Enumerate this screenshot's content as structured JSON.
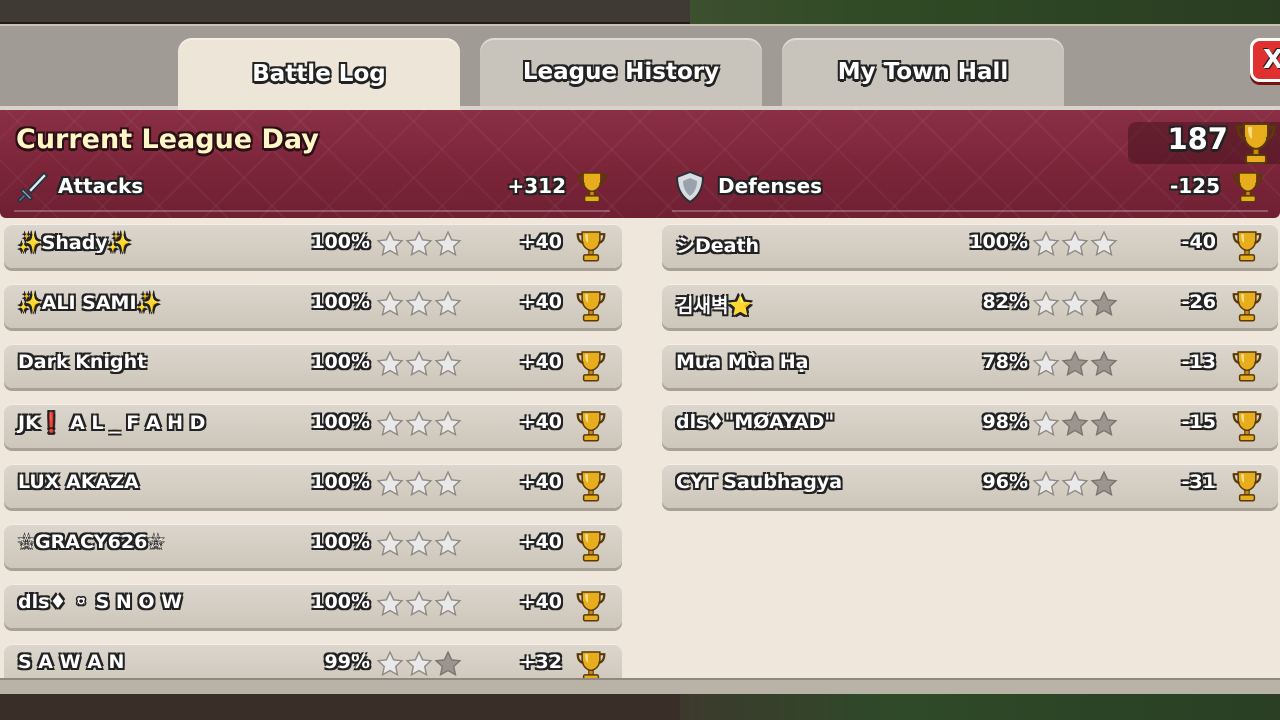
{
  "tabs": [
    {
      "label": "Battle Log",
      "active": true
    },
    {
      "label": "League History",
      "active": false
    },
    {
      "label": "My Town Hall",
      "active": false
    }
  ],
  "close_label": "X",
  "league": {
    "title": "Current League Day",
    "total_trophies": "187"
  },
  "attacks": {
    "label": "Attacks",
    "total": "+312",
    "rows": [
      {
        "name": "✨Shady✨",
        "percent": "100%",
        "stars": 3,
        "trophies": "+40"
      },
      {
        "name": "✨ALI SAMI✨",
        "percent": "100%",
        "stars": 3,
        "trophies": "+40"
      },
      {
        "name": "Dark Knight",
        "percent": "100%",
        "stars": 3,
        "trophies": "+40"
      },
      {
        "name": "JK❗ A L _ F A H D",
        "percent": "100%",
        "stars": 3,
        "trophies": "+40"
      },
      {
        "name": "LUX AKAZA",
        "percent": "100%",
        "stars": 3,
        "trophies": "+40"
      },
      {
        "name": "☆GRACY626☆",
        "percent": "100%",
        "stars": 3,
        "trophies": "+40"
      },
      {
        "name": "dls♦ ⚬ S N O W",
        "percent": "100%",
        "stars": 3,
        "trophies": "+40"
      },
      {
        "name": "S A W A N",
        "percent": "99%",
        "stars": 2,
        "trophies": "+32"
      }
    ]
  },
  "defenses": {
    "label": "Defenses",
    "total": "-125",
    "rows": [
      {
        "name": "シDeath",
        "percent": "100%",
        "stars": 3,
        "trophies": "-40"
      },
      {
        "name": "김새벽⭐",
        "percent": "82%",
        "stars": 2,
        "trophies": "-26"
      },
      {
        "name": "Mưa Mùa Hạ",
        "percent": "78%",
        "stars": 1,
        "trophies": "-13"
      },
      {
        "name": "dls♦\"MØAYAD\"",
        "percent": "98%",
        "stars": 1,
        "trophies": "-15"
      },
      {
        "name": "CYT Saubhagya",
        "percent": "96%",
        "stars": 2,
        "trophies": "-31"
      }
    ]
  },
  "colors": {
    "league_band": "#7a2438",
    "panel": "#efe7dc",
    "row": "#d5cec3",
    "star_on": "#e9e9e9",
    "star_off": "#9a958e",
    "trophy": "#e2a51a",
    "close": "#e03030"
  },
  "icons": {
    "attack": "sword-icon",
    "defense": "shield-icon",
    "trophy": "trophy-icon",
    "star": "star-icon",
    "close": "close-icon"
  }
}
